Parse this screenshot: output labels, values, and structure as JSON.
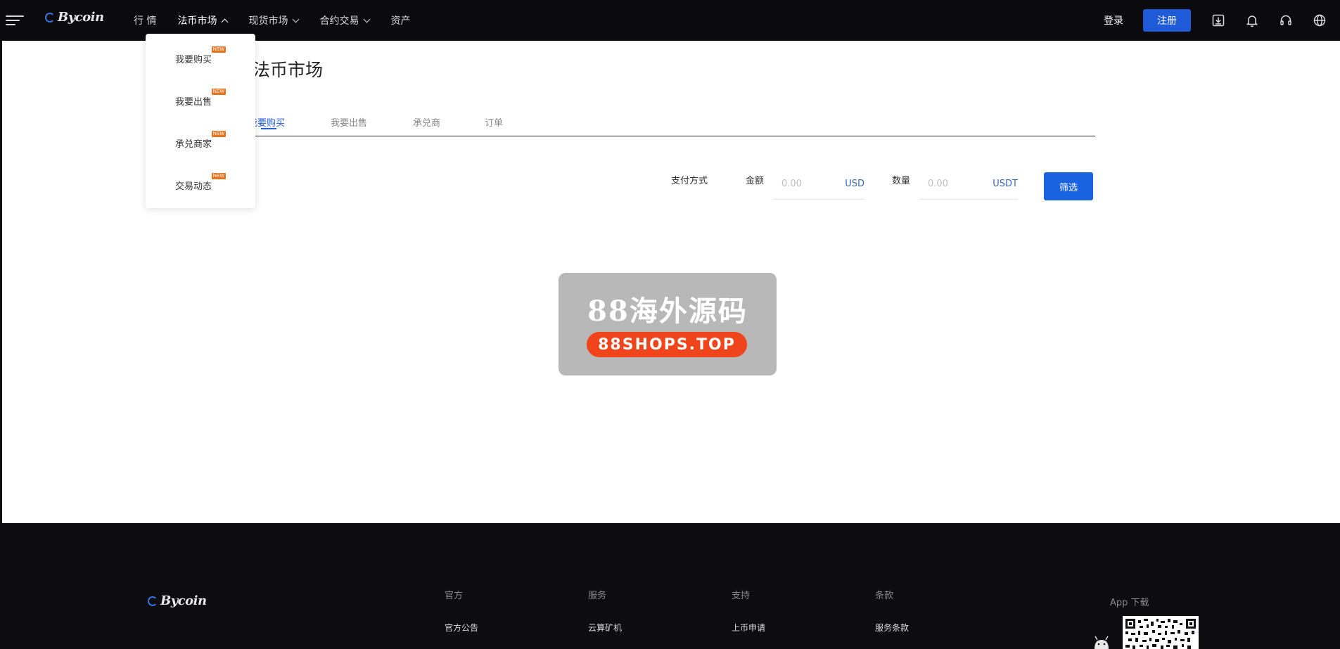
{
  "header": {
    "logo": "Bycoin",
    "nav": [
      {
        "label": "行 情",
        "has_dropdown": false,
        "active": false
      },
      {
        "label": "法币市场",
        "has_dropdown": true,
        "active": true
      },
      {
        "label": "现货市场",
        "has_dropdown": true,
        "active": false
      },
      {
        "label": "合约交易",
        "has_dropdown": true,
        "active": false
      },
      {
        "label": "资产",
        "has_dropdown": false,
        "active": false
      }
    ],
    "login_label": "登录",
    "register_label": "注册",
    "icons": [
      "download-icon",
      "bell-icon",
      "headset-icon",
      "globe-icon"
    ]
  },
  "dropdown": {
    "items": [
      {
        "label": "我要购买",
        "badge": "NEW"
      },
      {
        "label": "我要出售",
        "badge": "NEW"
      },
      {
        "label": "承兑商家",
        "badge": "NEW"
      },
      {
        "label": "交易动态",
        "badge": "NEW"
      }
    ]
  },
  "main": {
    "title": "法币市场",
    "tabs": [
      {
        "label": "我要购买",
        "active": true
      },
      {
        "label": "我要出售",
        "active": false
      },
      {
        "label": "承兑商",
        "active": false
      },
      {
        "label": "订单",
        "active": false
      }
    ],
    "filter": {
      "payment_label": "支付方式",
      "amount_label": "金额",
      "amount_placeholder": "0.00",
      "amount_unit": "USD",
      "quantity_label": "数量",
      "quantity_placeholder": "0.00",
      "quantity_unit": "USDT",
      "filter_button": "筛选"
    }
  },
  "watermark": {
    "title": "88海外源码",
    "url": "88SHOPS.TOP"
  },
  "footer": {
    "logo": "Bycoin",
    "columns": [
      {
        "title": "官方",
        "link": "官方公告"
      },
      {
        "title": "服务",
        "link": "云算矿机"
      },
      {
        "title": "支持",
        "link": "上币申请"
      },
      {
        "title": "条款",
        "link": "服务条款"
      }
    ],
    "app_download": "App 下载"
  },
  "colors": {
    "topbar_bg": "#0b0b0e",
    "accent_blue": "#1f5bd8",
    "badge_orange": "#e8731f",
    "footer_bg": "#0d0d10"
  }
}
